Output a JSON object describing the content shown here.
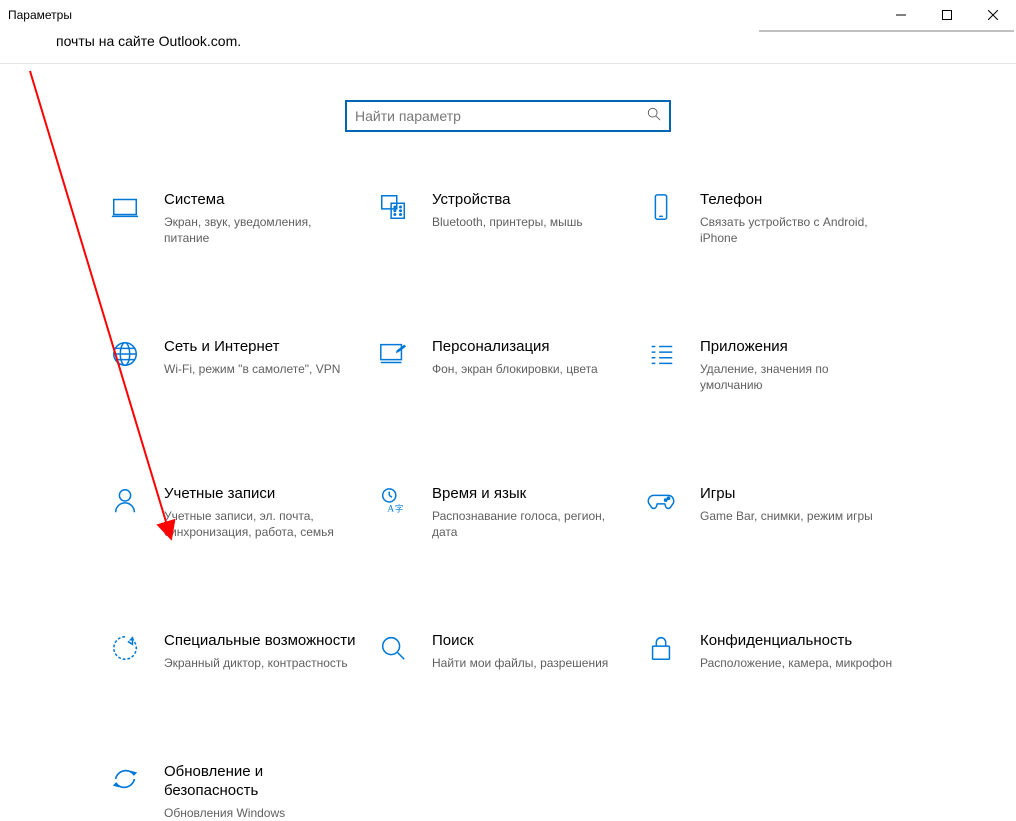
{
  "window": {
    "title": "Параметры",
    "subtext": "почты на сайте Outlook.com."
  },
  "search": {
    "placeholder": "Найти параметр"
  },
  "items": [
    {
      "title": "Система",
      "desc": "Экран, звук, уведомления, питание"
    },
    {
      "title": "Устройства",
      "desc": "Bluetooth, принтеры, мышь"
    },
    {
      "title": "Телефон",
      "desc": "Связать устройство с Android, iPhone"
    },
    {
      "title": "Сеть и Интернет",
      "desc": "Wi-Fi, режим \"в самолете\", VPN"
    },
    {
      "title": "Персонализация",
      "desc": "Фон, экран блокировки, цвета"
    },
    {
      "title": "Приложения",
      "desc": "Удаление, значения по умолчанию"
    },
    {
      "title": "Учетные записи",
      "desc": "Учетные записи, эл. почта, синхронизация, работа, семья"
    },
    {
      "title": "Время и язык",
      "desc": "Распознавание голоса, регион, дата"
    },
    {
      "title": "Игры",
      "desc": "Game Bar, снимки, режим игры"
    },
    {
      "title": "Специальные возможности",
      "desc": "Экранный диктор, контрастность"
    },
    {
      "title": "Поиск",
      "desc": "Найти мои файлы, разрешения"
    },
    {
      "title": "Конфиденциальность",
      "desc": "Расположение, камера, микрофон"
    },
    {
      "title": "Обновление и безопасность",
      "desc": "Обновления Windows"
    }
  ],
  "colors": {
    "accent": "#0078d7"
  }
}
